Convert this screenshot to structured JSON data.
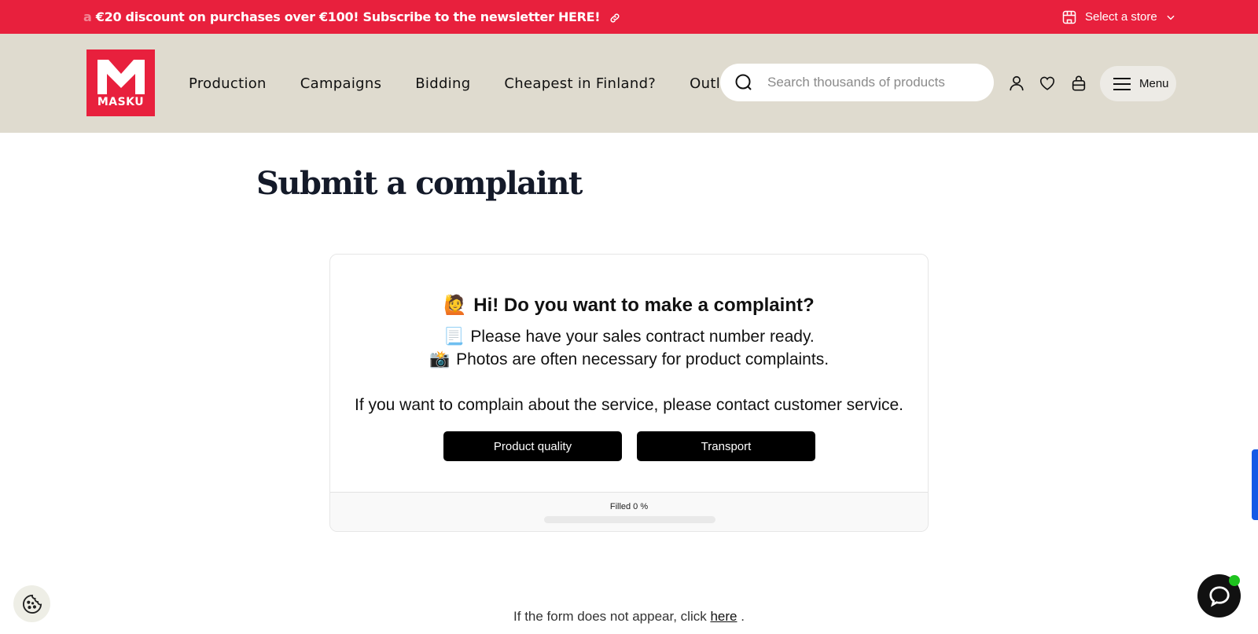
{
  "promo": {
    "lead_fragment": "a",
    "text": "€20 discount on purchases over €100! Subscribe to the newsletter HERE!",
    "store_select": "Select a store"
  },
  "header": {
    "logo_text": "MASKU",
    "nav": [
      "Production",
      "Campaigns",
      "Bidding",
      "Cheapest in Finland?",
      "Outlet"
    ],
    "search_placeholder": "Search thousands of products",
    "menu_label": "Menu"
  },
  "main": {
    "title": "Submit a complaint",
    "card": {
      "heading_emoji": "🙋",
      "heading": "Hi! Do you want to make a complaint?",
      "line1_emoji": "📃",
      "line1": "Please have your sales contract number ready.",
      "line2_emoji": "📸",
      "line2": "Photos are often necessary for product complaints.",
      "line3": "If you want to complain about the service, please contact customer service.",
      "buttons": [
        "Product quality",
        "Transport"
      ],
      "progress_label": "Filled 0 %",
      "progress_value": 0
    },
    "fallback_prefix": "If the form does not appear, click",
    "fallback_link": "here",
    "fallback_suffix": "."
  },
  "colors": {
    "brand_red": "#e8203d",
    "header_beige": "#dfdbcf",
    "title_navy": "#141a29",
    "chat_status": "#1ec31e"
  },
  "icons": [
    "link-icon",
    "store-icon",
    "chevron-down-icon",
    "search-icon",
    "user-icon",
    "heart-icon",
    "bag-icon",
    "hamburger-icon",
    "cookie-icon",
    "chat-icon"
  ]
}
